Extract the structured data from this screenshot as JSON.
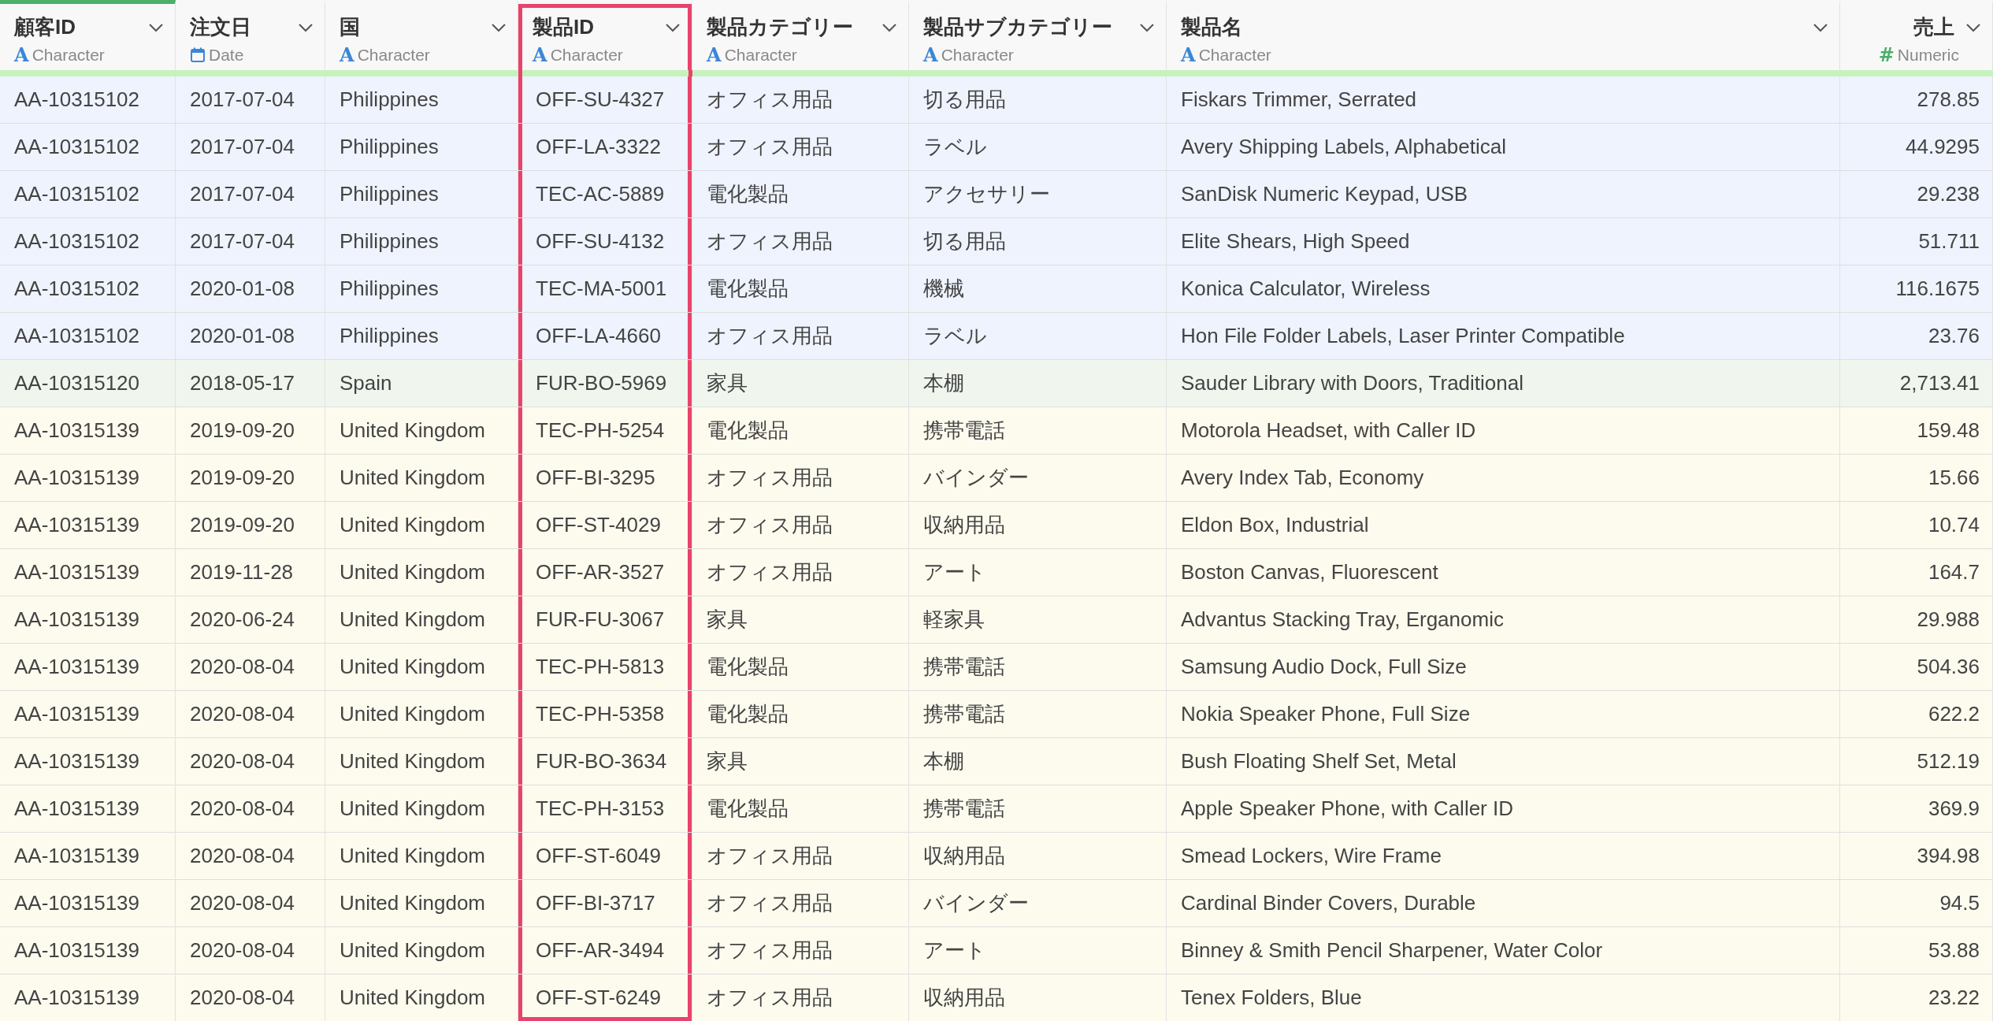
{
  "columns": [
    {
      "name": "顧客ID",
      "type": "Character",
      "kind": "character",
      "icon": "A",
      "sorted": true,
      "selected": false
    },
    {
      "name": "注文日",
      "type": "Date",
      "kind": "date",
      "sorted": false,
      "selected": false
    },
    {
      "name": "国",
      "type": "Character",
      "kind": "character",
      "icon": "A",
      "sorted": false,
      "selected": false
    },
    {
      "name": "製品ID",
      "type": "Character",
      "kind": "character",
      "icon": "A",
      "sorted": false,
      "selected": true
    },
    {
      "name": "製品カテゴリー",
      "type": "Character",
      "kind": "character",
      "icon": "A",
      "sorted": false,
      "selected": false
    },
    {
      "name": "製品サブカテゴリー",
      "type": "Character",
      "kind": "character",
      "icon": "A",
      "sorted": false,
      "selected": false
    },
    {
      "name": "製品名",
      "type": "Character",
      "kind": "character",
      "icon": "A",
      "sorted": false,
      "selected": false
    },
    {
      "name": "売上",
      "type": "Numeric",
      "kind": "numeric",
      "icon": "#",
      "sorted": false,
      "selected": false
    }
  ],
  "rows": [
    {
      "color": "#eef3fd",
      "cells": [
        "AA-10315102",
        "2017-07-04",
        "Philippines",
        "OFF-SU-4327",
        "オフィス用品",
        "切る用品",
        "Fiskars Trimmer, Serrated",
        "278.85"
      ]
    },
    {
      "color": "#eef3fd",
      "cells": [
        "AA-10315102",
        "2017-07-04",
        "Philippines",
        "OFF-LA-3322",
        "オフィス用品",
        "ラベル",
        "Avery Shipping Labels, Alphabetical",
        "44.9295"
      ]
    },
    {
      "color": "#eef3fd",
      "cells": [
        "AA-10315102",
        "2017-07-04",
        "Philippines",
        "TEC-AC-5889",
        "電化製品",
        "アクセサリー",
        "SanDisk Numeric Keypad, USB",
        "29.238"
      ]
    },
    {
      "color": "#eef3fd",
      "cells": [
        "AA-10315102",
        "2017-07-04",
        "Philippines",
        "OFF-SU-4132",
        "オフィス用品",
        "切る用品",
        "Elite Shears, High Speed",
        "51.711"
      ]
    },
    {
      "color": "#eef3fd",
      "cells": [
        "AA-10315102",
        "2020-01-08",
        "Philippines",
        "TEC-MA-5001",
        "電化製品",
        "機械",
        "Konica Calculator, Wireless",
        "116.1675"
      ]
    },
    {
      "color": "#eef3fd",
      "cells": [
        "AA-10315102",
        "2020-01-08",
        "Philippines",
        "OFF-LA-4660",
        "オフィス用品",
        "ラベル",
        "Hon File Folder Labels, Laser Printer Compatible",
        "23.76"
      ]
    },
    {
      "color": "#f0f6ee",
      "cells": [
        "AA-10315120",
        "2018-05-17",
        "Spain",
        "FUR-BO-5969",
        "家具",
        "本棚",
        "Sauder Library with Doors, Traditional",
        "2,713.41"
      ]
    },
    {
      "color": "#fdfbee",
      "cells": [
        "AA-10315139",
        "2019-09-20",
        "United Kingdom",
        "TEC-PH-5254",
        "電化製品",
        "携帯電話",
        "Motorola Headset, with Caller ID",
        "159.48"
      ]
    },
    {
      "color": "#fdfbee",
      "cells": [
        "AA-10315139",
        "2019-09-20",
        "United Kingdom",
        "OFF-BI-3295",
        "オフィス用品",
        "バインダー",
        "Avery Index Tab, Economy",
        "15.66"
      ]
    },
    {
      "color": "#fdfbee",
      "cells": [
        "AA-10315139",
        "2019-09-20",
        "United Kingdom",
        "OFF-ST-4029",
        "オフィス用品",
        "収納用品",
        "Eldon Box, Industrial",
        "10.74"
      ]
    },
    {
      "color": "#fdfbee",
      "cells": [
        "AA-10315139",
        "2019-11-28",
        "United Kingdom",
        "OFF-AR-3527",
        "オフィス用品",
        "アート",
        "Boston Canvas, Fluorescent",
        "164.7"
      ]
    },
    {
      "color": "#fdfbee",
      "cells": [
        "AA-10315139",
        "2020-06-24",
        "United Kingdom",
        "FUR-FU-3067",
        "家具",
        "軽家具",
        "Advantus Stacking Tray, Erganomic",
        "29.988"
      ]
    },
    {
      "color": "#fdfbee",
      "cells": [
        "AA-10315139",
        "2020-08-04",
        "United Kingdom",
        "TEC-PH-5813",
        "電化製品",
        "携帯電話",
        "Samsung Audio Dock, Full Size",
        "504.36"
      ]
    },
    {
      "color": "#fdfbee",
      "cells": [
        "AA-10315139",
        "2020-08-04",
        "United Kingdom",
        "TEC-PH-5358",
        "電化製品",
        "携帯電話",
        "Nokia Speaker Phone, Full Size",
        "622.2"
      ]
    },
    {
      "color": "#fdfbee",
      "cells": [
        "AA-10315139",
        "2020-08-04",
        "United Kingdom",
        "FUR-BO-3634",
        "家具",
        "本棚",
        "Bush Floating Shelf Set, Metal",
        "512.19"
      ]
    },
    {
      "color": "#fdfbee",
      "cells": [
        "AA-10315139",
        "2020-08-04",
        "United Kingdom",
        "TEC-PH-3153",
        "電化製品",
        "携帯電話",
        "Apple Speaker Phone, with Caller ID",
        "369.9"
      ]
    },
    {
      "color": "#fdfbee",
      "cells": [
        "AA-10315139",
        "2020-08-04",
        "United Kingdom",
        "OFF-ST-6049",
        "オフィス用品",
        "収納用品",
        "Smead Lockers, Wire Frame",
        "394.98"
      ]
    },
    {
      "color": "#fdfbee",
      "cells": [
        "AA-10315139",
        "2020-08-04",
        "United Kingdom",
        "OFF-BI-3717",
        "オフィス用品",
        "バインダー",
        "Cardinal Binder Covers, Durable",
        "94.5"
      ]
    },
    {
      "color": "#fdfbee",
      "cells": [
        "AA-10315139",
        "2020-08-04",
        "United Kingdom",
        "OFF-AR-3494",
        "オフィス用品",
        "アート",
        "Binney & Smith Pencil Sharpener, Water Color",
        "53.88"
      ]
    },
    {
      "color": "#fdfbee",
      "cells": [
        "AA-10315139",
        "2020-08-04",
        "United Kingdom",
        "OFF-ST-6249",
        "オフィス用品",
        "収納用品",
        "Tenex Folders, Blue",
        "23.22"
      ]
    }
  ]
}
